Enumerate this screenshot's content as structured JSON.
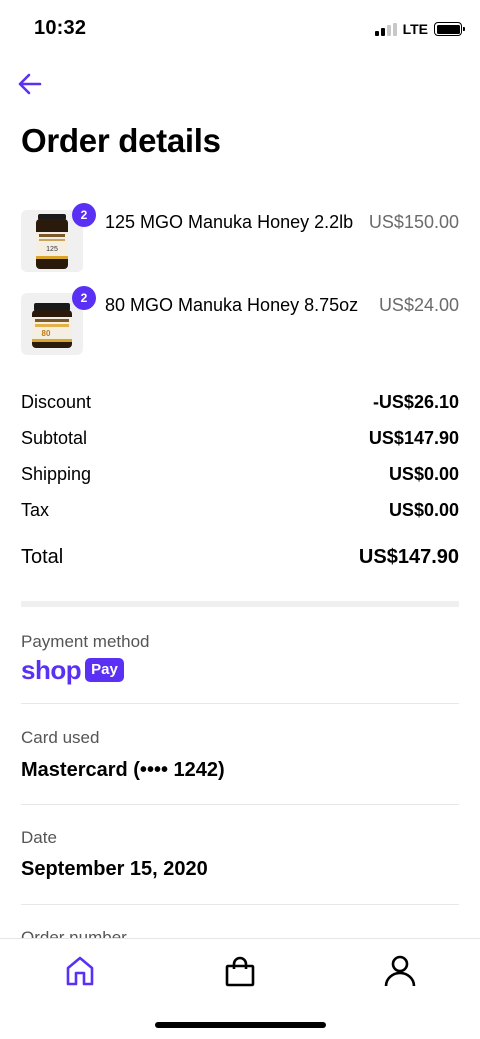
{
  "status_bar": {
    "time": "10:32",
    "network": "LTE"
  },
  "header": {
    "back_icon": "arrow-left-icon",
    "title": "Order details"
  },
  "items": [
    {
      "name": "125 MGO Manuka Honey 2.2lb",
      "price": "US$150.00",
      "quantity": "2",
      "jar_label": "125"
    },
    {
      "name": "80 MGO Manuka Honey 8.75oz",
      "price": "US$24.00",
      "quantity": "2",
      "jar_label": "80"
    }
  ],
  "summary": {
    "discount_label": "Discount",
    "discount_value": "-US$26.10",
    "subtotal_label": "Subtotal",
    "subtotal_value": "US$147.90",
    "shipping_label": "Shipping",
    "shipping_value": "US$0.00",
    "tax_label": "Tax",
    "tax_value": "US$0.00",
    "total_label": "Total",
    "total_value": "US$147.90"
  },
  "payment": {
    "label": "Payment method",
    "brand_word": "shop",
    "brand_pill": "Pay"
  },
  "card": {
    "label": "Card used",
    "value": "Mastercard (•••• 1242)"
  },
  "date": {
    "label": "Date",
    "value": "September 15, 2020"
  },
  "order_number": {
    "label": "Order number"
  },
  "tabs": [
    {
      "name": "home",
      "icon": "home-icon",
      "active": true
    },
    {
      "name": "shop",
      "icon": "shopping-bag-icon",
      "active": false
    },
    {
      "name": "account",
      "icon": "user-icon",
      "active": false
    }
  ],
  "colors": {
    "accent": "#5a31f4",
    "muted": "#6b6b6b",
    "divider": "#efefef"
  }
}
